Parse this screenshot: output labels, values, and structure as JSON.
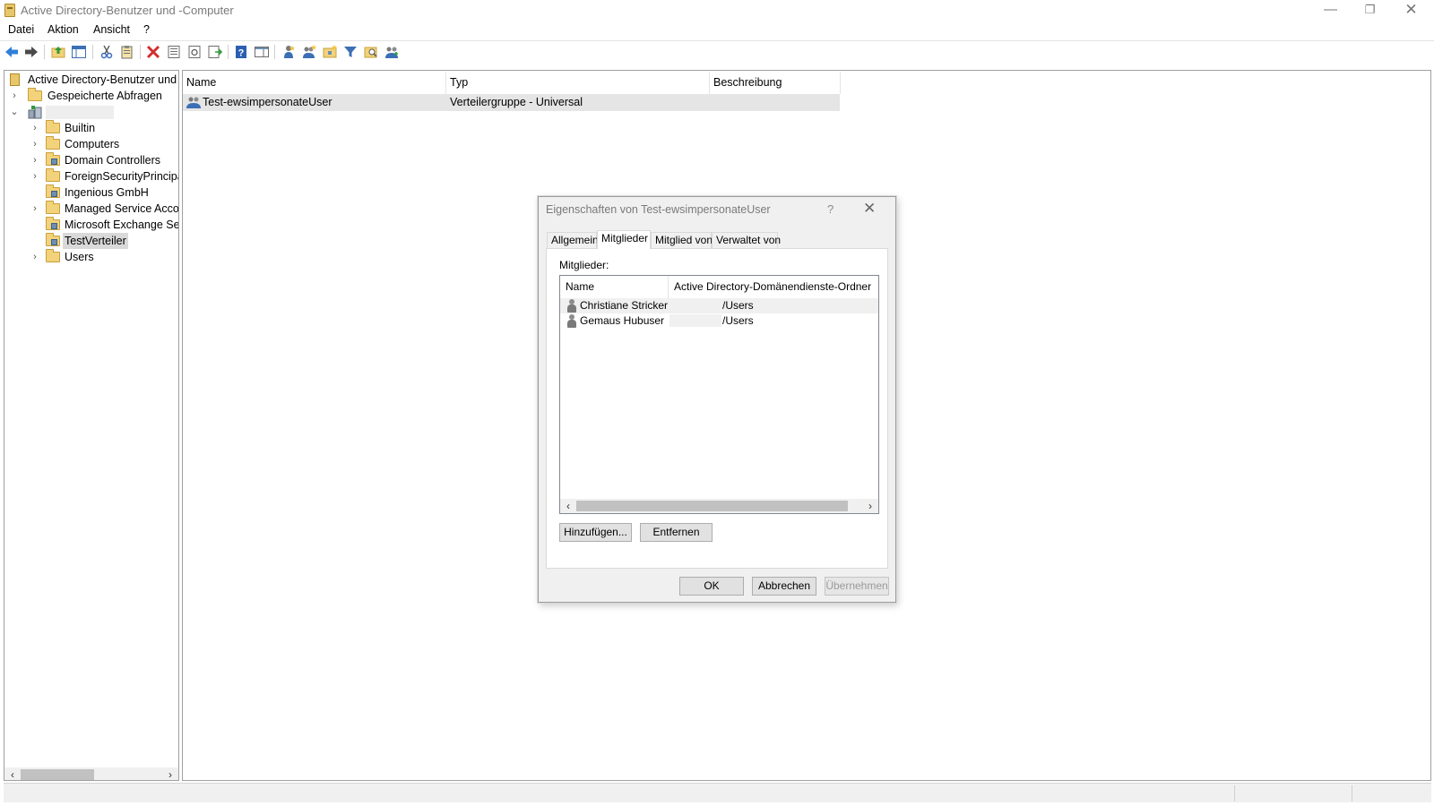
{
  "window": {
    "title": "Active Directory-Benutzer und -Computer",
    "controls": {
      "minimize": "—",
      "restore": "❐",
      "close": "✕"
    }
  },
  "menu": [
    {
      "label": "Datei"
    },
    {
      "label": "Aktion"
    },
    {
      "label": "Ansicht"
    },
    {
      "label": "?"
    }
  ],
  "toolbar_icons": [
    "back-icon",
    "forward-icon",
    "up-folder-icon",
    "show-hide-tree-icon",
    "cut-icon",
    "copy-icon",
    "delete-icon",
    "properties-icon",
    "refresh-icon",
    "export-list-icon",
    "help-icon",
    "show-action-pane-icon",
    "create-user-icon",
    "create-group-icon",
    "create-ou-icon",
    "filter-icon",
    "find-icon",
    "add-to-group-icon"
  ],
  "tree": {
    "root": "Active Directory-Benutzer und -Computer",
    "saved_queries": "Gespeicherte Abfragen",
    "domain": "",
    "items": [
      {
        "label": "Builtin",
        "type": "container",
        "expandable": true
      },
      {
        "label": "Computers",
        "type": "container",
        "expandable": true
      },
      {
        "label": "Domain Controllers",
        "type": "ou",
        "expandable": true
      },
      {
        "label": "ForeignSecurityPrincipals",
        "type": "container",
        "expandable": true
      },
      {
        "label": "Ingenious GmbH",
        "type": "ou",
        "expandable": false
      },
      {
        "label": "Managed Service Accounts",
        "type": "container",
        "expandable": true
      },
      {
        "label": "Microsoft Exchange Security Groups",
        "type": "ou",
        "expandable": false
      },
      {
        "label": "TestVerteiler",
        "type": "ou",
        "expandable": false,
        "selected": true
      },
      {
        "label": "Users",
        "type": "container",
        "expandable": true
      }
    ]
  },
  "list": {
    "columns": [
      "Name",
      "Typ",
      "Beschreibung"
    ],
    "rows": [
      {
        "name": "Test-ewsimpersonateUser",
        "type": "Verteilergruppe - Universal",
        "description": ""
      }
    ]
  },
  "dialog": {
    "title": "Eigenschaften von Test-ewsimpersonateUser",
    "help": "?",
    "close": "✕",
    "tabs": [
      "Allgemein",
      "Mitglieder",
      "Mitglied von",
      "Verwaltet von"
    ],
    "active_tab": "Mitglieder",
    "members_label": "Mitglieder:",
    "columns": [
      "Name",
      "Active Directory-Domänendienste-Ordner"
    ],
    "members": [
      {
        "name": "Christiane Stricker",
        "folder": "/Users"
      },
      {
        "name": "Gemaus Hubuser",
        "folder": "/Users"
      }
    ],
    "buttons": {
      "add": "Hinzufügen...",
      "remove": "Entfernen",
      "ok": "OK",
      "cancel": "Abbrechen",
      "apply": "Übernehmen"
    }
  },
  "colors": {
    "selection_gray": "#d9d9d9",
    "folder_yellow": "#f2d27a",
    "delete_red": "#d32f2f",
    "help_blue": "#2c5fb3"
  }
}
